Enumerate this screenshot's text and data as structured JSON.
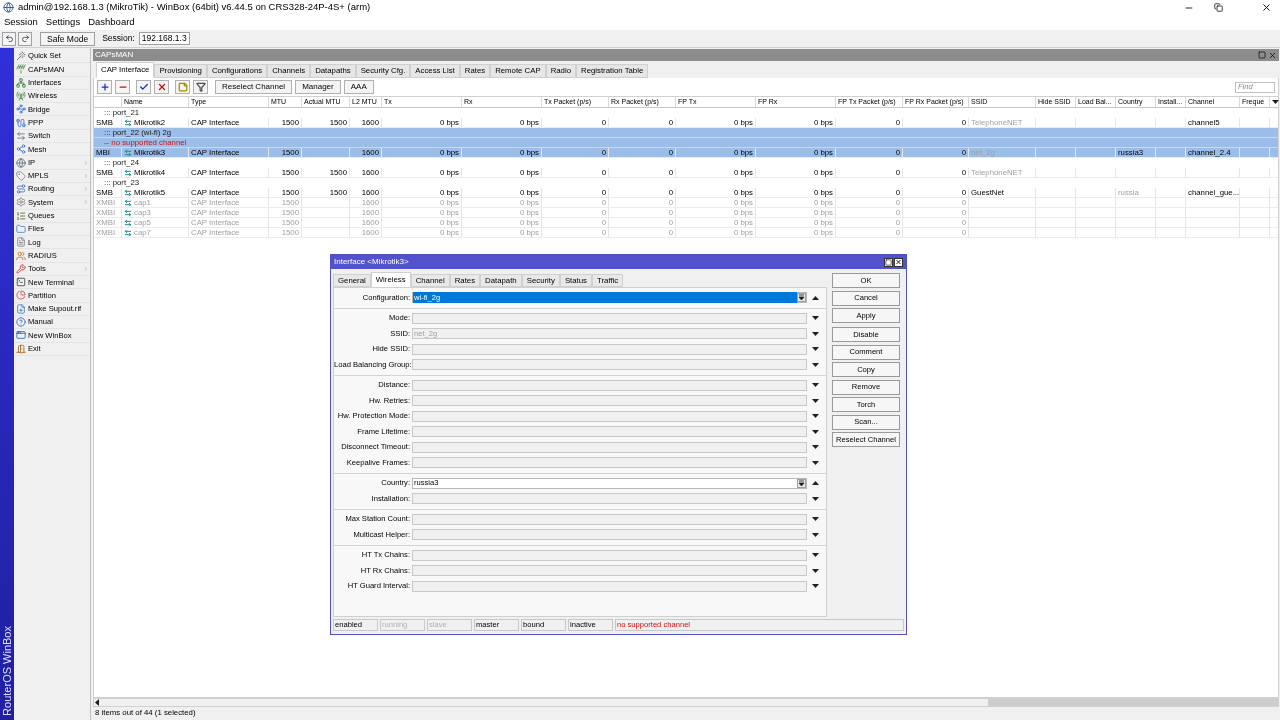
{
  "window": {
    "title": "admin@192.168.1.3 (MikroTik) - WinBox (64bit) v6.44.5 on CRS328-24P-4S+ (arm)"
  },
  "menu": [
    "Session",
    "Settings",
    "Dashboard"
  ],
  "toolbar": {
    "safe_mode": "Safe Mode",
    "session_label": "Session:",
    "session_value": "192.168.1.3"
  },
  "brand": "RouterOS WinBox",
  "sidebar": {
    "items": [
      {
        "label": "Quick Set",
        "submenu": false
      },
      {
        "label": "CAPsMAN",
        "submenu": false
      },
      {
        "label": "Interfaces",
        "submenu": false
      },
      {
        "label": "Wireless",
        "submenu": false
      },
      {
        "label": "Bridge",
        "submenu": false
      },
      {
        "label": "PPP",
        "submenu": false
      },
      {
        "label": "Switch",
        "submenu": false
      },
      {
        "label": "Mesh",
        "submenu": false
      },
      {
        "label": "IP",
        "submenu": true
      },
      {
        "label": "MPLS",
        "submenu": true
      },
      {
        "label": "Routing",
        "submenu": true
      },
      {
        "label": "System",
        "submenu": true
      },
      {
        "label": "Queues",
        "submenu": false
      },
      {
        "label": "Files",
        "submenu": false
      },
      {
        "label": "Log",
        "submenu": false
      },
      {
        "label": "RADIUS",
        "submenu": false
      },
      {
        "label": "Tools",
        "submenu": true
      },
      {
        "label": "New Terminal",
        "submenu": false
      },
      {
        "label": "Partition",
        "submenu": false
      },
      {
        "label": "Make Supout.rif",
        "submenu": false
      },
      {
        "label": "Manual",
        "submenu": false
      },
      {
        "label": "New WinBox",
        "submenu": false
      },
      {
        "label": "Exit",
        "submenu": false
      }
    ]
  },
  "capsman": {
    "title": "CAPsMAN",
    "tabs": [
      {
        "label": "CAP Interface",
        "selected": true
      },
      {
        "label": "Provisioning",
        "selected": false
      },
      {
        "label": "Configurations",
        "selected": false
      },
      {
        "label": "Channels",
        "selected": false
      },
      {
        "label": "Datapaths",
        "selected": false
      },
      {
        "label": "Security Cfg.",
        "selected": false
      },
      {
        "label": "Access List",
        "selected": false
      },
      {
        "label": "Rates",
        "selected": false
      },
      {
        "label": "Remote CAP",
        "selected": false
      },
      {
        "label": "Radio",
        "selected": false
      },
      {
        "label": "Registration Table",
        "selected": false
      }
    ],
    "toolbar_buttons": [
      "Reselect Channel",
      "Manager",
      "AAA"
    ],
    "find": {
      "placeholder": "Find"
    },
    "columns": [
      "",
      "Name",
      "Type",
      "MTU",
      "Actual MTU",
      "L2 MTU",
      "Tx",
      "Rx",
      "Tx Packet (p/s)",
      "Rx Packet (p/s)",
      "FP Tx",
      "FP Rx",
      "FP Tx Packet (p/s)",
      "FP Rx Packet (p/s)",
      "SSID",
      "Hide SSID",
      "Load Bal...",
      "Country",
      "Install...",
      "Channel",
      "Freque"
    ],
    "rows": [
      {
        "comments": [
          {
            "text": "::: port_21",
            "kind": "note"
          }
        ],
        "selected": false,
        "disabled": false,
        "cells": [
          "SMB",
          "Mikrotik2",
          "CAP Interface",
          "1500",
          "1500",
          "1600",
          "0 bps",
          "0 bps",
          "0",
          "0",
          "0 bps",
          "0 bps",
          "0",
          "0",
          {
            "text": "TelephoneNET",
            "inherited": true
          },
          null,
          null,
          null,
          null,
          "channel5",
          null
        ]
      },
      {
        "comments": [
          {
            "text": "::: port_22 (wi-fi) 2g",
            "kind": "note"
          },
          {
            "text": "-- no supported channel",
            "kind": "error"
          }
        ],
        "selected": true,
        "disabled": false,
        "cells": [
          "MBI",
          "Mikrotik3",
          "CAP Interface",
          "1500",
          null,
          "1600",
          "0 bps",
          "0 bps",
          "0",
          "0",
          "0 bps",
          "0 bps",
          "0",
          "0",
          {
            "text": "net_2g",
            "inherited": true
          },
          null,
          null,
          "russia3",
          null,
          "channel_2.4",
          null
        ]
      },
      {
        "comments": [
          {
            "text": "::: port_24",
            "kind": "note"
          }
        ],
        "selected": false,
        "disabled": false,
        "cells": [
          "SMB",
          "Mikrotik4",
          "CAP Interface",
          "1500",
          "1500",
          "1600",
          "0 bps",
          "0 bps",
          "0",
          "0",
          "0 bps",
          "0 bps",
          "0",
          "0",
          {
            "text": "TelephoneNET",
            "inherited": true
          },
          null,
          null,
          null,
          null,
          null,
          null
        ]
      },
      {
        "comments": [
          {
            "text": "::: port_23",
            "kind": "note"
          }
        ],
        "selected": false,
        "disabled": false,
        "cells": [
          "SMB",
          "Mikrotik5",
          "CAP Interface",
          "1500",
          "1500",
          "1600",
          "0 bps",
          "0 bps",
          "0",
          "0",
          "0 bps",
          "0 bps",
          "0",
          "0",
          "GuestNet",
          null,
          null,
          {
            "text": "russia",
            "inherited": true
          },
          null,
          "channel_gue...",
          null
        ]
      },
      {
        "comments": [],
        "selected": false,
        "disabled": true,
        "cells": [
          "XMBI",
          "cap1",
          "CAP Interface",
          "1500",
          null,
          "1600",
          "0 bps",
          "0 bps",
          "0",
          "0",
          "0 bps",
          "0 bps",
          "0",
          "0",
          null,
          null,
          null,
          null,
          null,
          null,
          null
        ]
      },
      {
        "comments": [],
        "selected": false,
        "disabled": true,
        "cells": [
          "XMBI",
          "cap3",
          "CAP Interface",
          "1500",
          null,
          "1600",
          "0 bps",
          "0 bps",
          "0",
          "0",
          "0 bps",
          "0 bps",
          "0",
          "0",
          null,
          null,
          null,
          null,
          null,
          null,
          null
        ]
      },
      {
        "comments": [],
        "selected": false,
        "disabled": true,
        "cells": [
          "XMBI",
          "cap5",
          "CAP Interface",
          "1500",
          null,
          "1600",
          "0 bps",
          "0 bps",
          "0",
          "0",
          "0 bps",
          "0 bps",
          "0",
          "0",
          null,
          null,
          null,
          null,
          null,
          null,
          null
        ]
      },
      {
        "comments": [],
        "selected": false,
        "disabled": true,
        "cells": [
          "XMBI",
          "cap7",
          "CAP Interface",
          "1500",
          null,
          "1600",
          "0 bps",
          "0 bps",
          "0",
          "0",
          "0 bps",
          "0 bps",
          "0",
          "0",
          null,
          null,
          null,
          null,
          null,
          null,
          null
        ]
      }
    ],
    "status": "8 items out of 44 (1 selected)"
  },
  "dialog": {
    "title": "Interface <Mikrotik3>",
    "tabs": [
      {
        "label": "General",
        "selected": false
      },
      {
        "label": "Wireless",
        "selected": true
      },
      {
        "label": "Channel",
        "selected": false
      },
      {
        "label": "Rates",
        "selected": false
      },
      {
        "label": "Datapath",
        "selected": false
      },
      {
        "label": "Security",
        "selected": false
      },
      {
        "label": "Status",
        "selected": false
      },
      {
        "label": "Traffic",
        "selected": false
      }
    ],
    "groups": [
      [
        {
          "label": "Configuration:",
          "kind": "combo",
          "value": "wi-fi_2g",
          "highlighted": true
        }
      ],
      [
        {
          "label": "Mode:",
          "kind": "select"
        },
        {
          "label": "SSID:",
          "kind": "select",
          "value": "net_2g",
          "inherited": true
        },
        {
          "label": "Hide SSID:",
          "kind": "select"
        },
        {
          "label": "Load Balancing Group:",
          "kind": "select"
        }
      ],
      [
        {
          "label": "Distance:",
          "kind": "select"
        },
        {
          "label": "Hw. Retries:",
          "kind": "select"
        },
        {
          "label": "Hw. Protection Mode:",
          "kind": "select"
        },
        {
          "label": "Frame Lifetime:",
          "kind": "select"
        },
        {
          "label": "Disconnect Timeout:",
          "kind": "select"
        },
        {
          "label": "Keepalive Frames:",
          "kind": "select"
        }
      ],
      [
        {
          "label": "Country:",
          "kind": "combo",
          "value": "russia3",
          "highlighted": false
        },
        {
          "label": "Installation:",
          "kind": "select"
        }
      ],
      [
        {
          "label": "Max Station Count:",
          "kind": "select"
        },
        {
          "label": "Multicast Helper:",
          "kind": "select"
        }
      ],
      [
        {
          "label": "HT Tx Chains:",
          "kind": "select"
        },
        {
          "label": "HT Rx Chains:",
          "kind": "select"
        },
        {
          "label": "HT Guard Interval:",
          "kind": "select"
        }
      ]
    ],
    "buttons": [
      [
        "OK",
        "Cancel",
        "Apply"
      ],
      [
        "Disable",
        "Comment",
        "Copy",
        "Remove",
        "Torch",
        "Scan...",
        "Reselect Channel"
      ]
    ],
    "status": [
      {
        "text": "enabled",
        "kind": "normal"
      },
      {
        "text": "running",
        "kind": "dim"
      },
      {
        "text": "slave",
        "kind": "dim"
      },
      {
        "text": "master",
        "kind": "normal"
      },
      {
        "text": "bound",
        "kind": "normal"
      },
      {
        "text": "inactive",
        "kind": "normal"
      },
      {
        "text": "no supported channel",
        "kind": "error"
      }
    ]
  }
}
